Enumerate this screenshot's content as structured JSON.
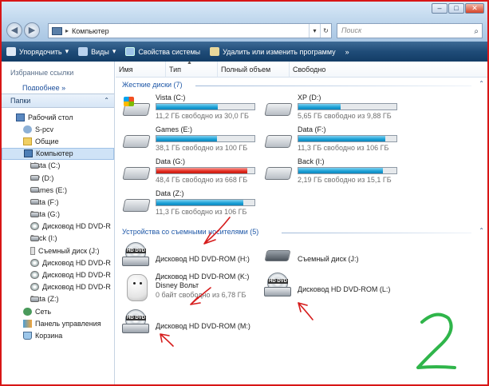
{
  "window": {
    "breadcrumb": "Компьютер",
    "search_placeholder": "Поиск",
    "controls": [
      "–",
      "□",
      "✕"
    ]
  },
  "toolbar": {
    "organize": "Упорядочить",
    "views": "Виды",
    "system_properties": "Свойства системы",
    "uninstall": "Удалить или изменить программу"
  },
  "sidebar": {
    "favorite_links": "Избранные ссылки",
    "more_link": "Подробнее »",
    "folders": "Папки",
    "items": [
      {
        "label": "Рабочий стол",
        "icon": "desktop-icon",
        "level": 0
      },
      {
        "label": "S-pcv",
        "icon": "user-icon",
        "level": 1
      },
      {
        "label": "Общие",
        "icon": "folder-icon",
        "level": 1
      },
      {
        "label": "Компьютер",
        "icon": "computer-icon",
        "level": 1,
        "selected": true
      },
      {
        "label": "Vista (C:)",
        "icon": "drive-icon",
        "level": 2
      },
      {
        "label": "XP (D:)",
        "icon": "drive-icon",
        "level": 2
      },
      {
        "label": "Games (E:)",
        "icon": "drive-icon",
        "level": 2
      },
      {
        "label": "Data (F:)",
        "icon": "drive-icon",
        "level": 2
      },
      {
        "label": "Data (G:)",
        "icon": "drive-icon",
        "level": 2
      },
      {
        "label": "Дисковод HD DVD-R",
        "icon": "dvd-icon",
        "level": 2
      },
      {
        "label": "Back (I:)",
        "icon": "drive-icon",
        "level": 2
      },
      {
        "label": "Съемный диск (J:)",
        "icon": "usb-icon",
        "level": 2
      },
      {
        "label": "Дисковод HD DVD-R",
        "icon": "dvd-icon",
        "level": 2
      },
      {
        "label": "Дисковод HD DVD-R",
        "icon": "dvd-icon",
        "level": 2
      },
      {
        "label": "Дисковод HD DVD-R",
        "icon": "dvd-icon",
        "level": 2
      },
      {
        "label": "Data (Z:)",
        "icon": "drive-icon",
        "level": 2
      },
      {
        "label": "Сеть",
        "icon": "network-icon",
        "level": 1
      },
      {
        "label": "Панель управления",
        "icon": "control-panel-icon",
        "level": 1
      },
      {
        "label": "Корзина",
        "icon": "recycle-bin-icon",
        "level": 1
      }
    ]
  },
  "columns": [
    "Имя",
    "Тип",
    "Полный объем",
    "Свободно"
  ],
  "groups": {
    "hard_disks": "Жесткие диски (7)",
    "removable": "Устройства со съемными носителями (5)"
  },
  "hard_disks": [
    {
      "name": "Vista (C:)",
      "free": "11,2 ГБ свободно из 30,0 ГБ",
      "used_fraction": 0.63,
      "warn": false
    },
    {
      "name": "XP (D:)",
      "free": "5,65 ГБ свободно из 9,88 ГБ",
      "used_fraction": 0.43,
      "warn": false
    },
    {
      "name": "Games (E:)",
      "free": "38,1 ГБ свободно из 100 ГБ",
      "used_fraction": 0.62,
      "warn": false
    },
    {
      "name": "Data (F:)",
      "free": "11,3 ГБ свободно из 106 ГБ",
      "used_fraction": 0.89,
      "warn": false
    },
    {
      "name": "Data (G:)",
      "free": "48,4 ГБ свободно из 668 ГБ",
      "used_fraction": 0.93,
      "warn": true
    },
    {
      "name": "Back (I:)",
      "free": "2,19 ГБ свободно из 15,1 ГБ",
      "used_fraction": 0.86,
      "warn": false
    },
    {
      "name": "Data (Z:)",
      "free": "11,3 ГБ свободно из 106 ГБ",
      "used_fraction": 0.89,
      "warn": false
    }
  ],
  "removable": [
    {
      "name": "Дисковод HD DVD-ROM (H:)",
      "icon": "hd-dvd-drive-icon"
    },
    {
      "name": "Съемный диск (J:)",
      "icon": "removable-disk-icon"
    },
    {
      "name": "Дисковод HD DVD-ROM (K:)",
      "label2": "Disney Вольт",
      "free": "0 байт свободно из 6,78 ГБ",
      "icon": "dog-disc-icon"
    },
    {
      "name": "Дисковод HD DVD-ROM (L:)",
      "icon": "hd-dvd-drive-icon"
    },
    {
      "name": "Дисковод HD DVD-ROM (M:)",
      "icon": "hd-dvd-drive-icon"
    }
  ],
  "annotation": {
    "number": "2",
    "arrow_color": "#d61c1c",
    "number_color": "#2fb54a"
  },
  "dvd_label": "HD DVD",
  "colors": {
    "accent": "#1f58a8",
    "bar": "#1aa0d6",
    "bar_warn": "#e42b1f",
    "frame": "#d81616"
  }
}
